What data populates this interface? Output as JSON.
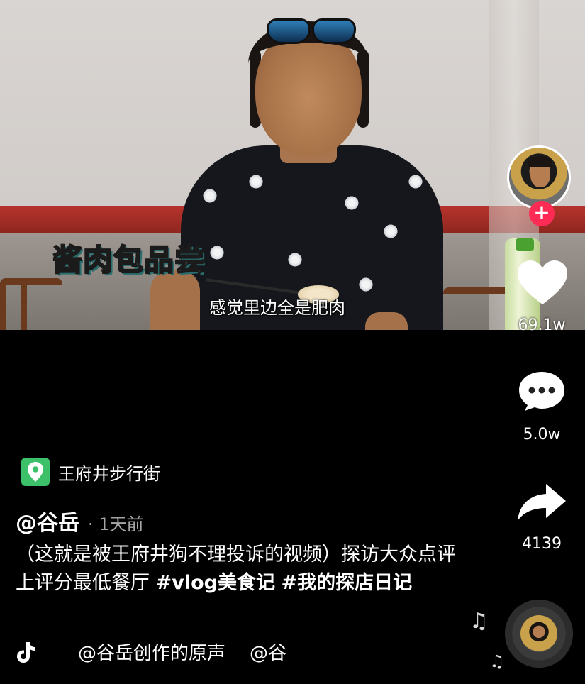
{
  "video": {
    "title_overlay": "酱肉包品尝",
    "subtitle": "感觉里边全是肥肉"
  },
  "rail": {
    "like_count": "69.1w",
    "comment_count": "5.0w",
    "share_count": "4139",
    "follow_symbol": "+"
  },
  "location": {
    "name": "王府井步行街"
  },
  "post": {
    "author": "@谷岳",
    "time": "· 1天前",
    "desc_text": "（这就是被王府井狗不理投诉的视频）探访大众点评上评分最低餐厅 ",
    "hashtag1": "#vlog美食记",
    "hashtag2": "#我的探店日记"
  },
  "music": {
    "sound_label": "@谷岳创作的原声",
    "sound_label2": "@谷"
  },
  "icons": {
    "location": "map-pin-icon",
    "like": "heart-icon",
    "comment": "comment-icon",
    "share": "share-icon",
    "music_logo": "tiktok-logo",
    "note": "music-note-icon"
  },
  "colors": {
    "accent_follow": "#fe2c55",
    "location_badge": "#3cc16a",
    "background": "#000000"
  }
}
